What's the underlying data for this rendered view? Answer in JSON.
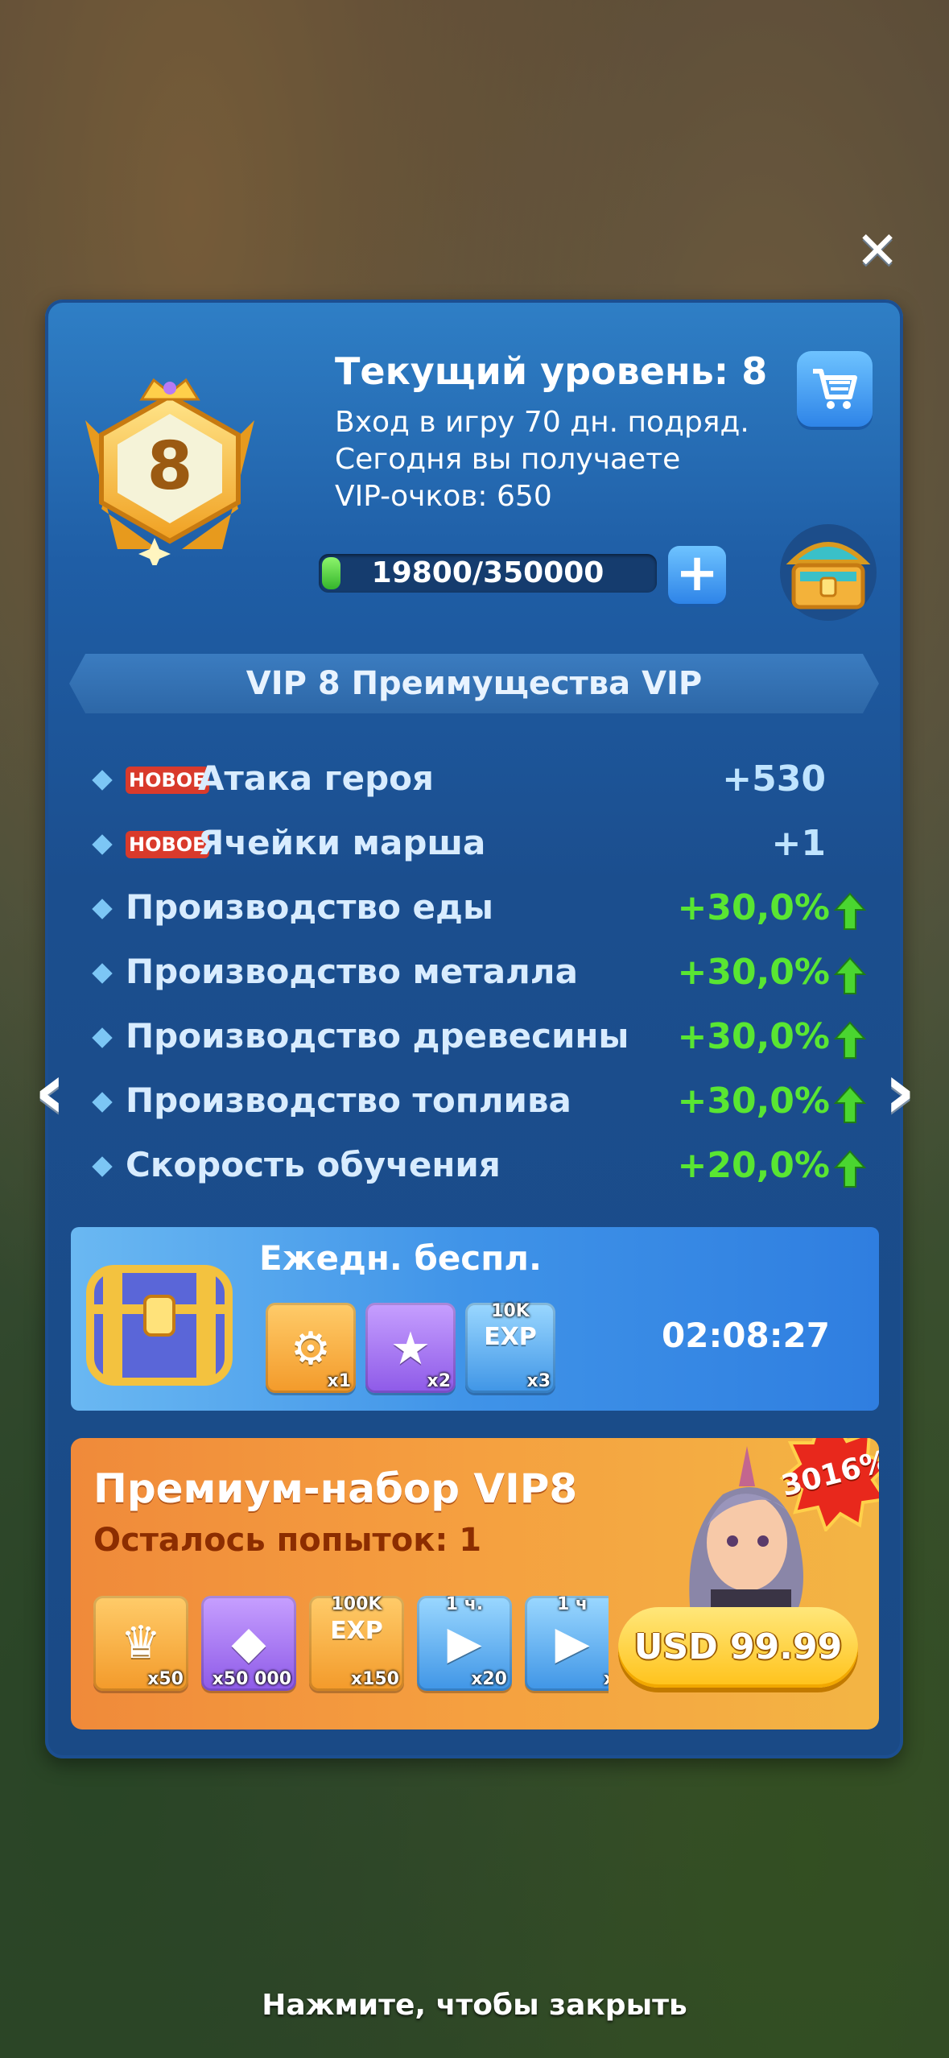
{
  "header": {
    "title": "Текущий уровень: 8",
    "lines": [
      "Вход в игру 70 дн. подряд.",
      "Сегодня вы получаете",
      "VIP-очков: 650"
    ],
    "badge_level": "8",
    "progress_text": "19800/350000",
    "progress_fraction": 0.0566
  },
  "benefits_title": "VIP 8 Преимущества VIP",
  "benefits": [
    {
      "new": "НОВОЕ",
      "label": "Атака героя",
      "value": "+530",
      "color": "blue",
      "arrow": false
    },
    {
      "new": "НОВОЕ",
      "label": "Ячейки марша",
      "value": "+1",
      "color": "blue",
      "arrow": false
    },
    {
      "new": "",
      "label": "Производство еды",
      "value": "+30,0%",
      "color": "green",
      "arrow": true
    },
    {
      "new": "",
      "label": "Производство металла",
      "value": "+30,0%",
      "color": "green",
      "arrow": true
    },
    {
      "new": "",
      "label": "Производство древесины",
      "value": "+30,0%",
      "color": "green",
      "arrow": true
    },
    {
      "new": "",
      "label": "Производство топлива",
      "value": "+30,0%",
      "color": "green",
      "arrow": true
    },
    {
      "new": "",
      "label": "Скорость обучения",
      "value": "+20,0%",
      "color": "green",
      "arrow": true
    }
  ],
  "daily": {
    "title": "Ежедн. беспл.",
    "timer": "02:08:27",
    "items": [
      {
        "icon": "speedup-badge-icon",
        "count": "x1",
        "top": "",
        "tile": "orange"
      },
      {
        "icon": "star-card-icon",
        "count": "x2",
        "top": "",
        "tile": "purple"
      },
      {
        "icon": "exp-badge-icon",
        "count": "x3",
        "top": "10K",
        "tile": "blue"
      }
    ]
  },
  "premium": {
    "title": "Премиум-набор VIP8",
    "subtitle": "Осталось попыток: 1",
    "percent": "3016%",
    "price": "USD 99.99",
    "items": [
      {
        "icon": "crown-coin-icon",
        "count": "x50",
        "top": "",
        "tile": "orange"
      },
      {
        "icon": "gem-icon",
        "count": "x50 000",
        "top": "",
        "tile": "purple"
      },
      {
        "icon": "exp-badge-icon",
        "count": "x150",
        "top": "100K",
        "tile": "orange"
      },
      {
        "icon": "hammer-speedup-icon",
        "count": "x20",
        "top": "1 ч.",
        "tile": "blue"
      },
      {
        "icon": "train-speedup-icon",
        "count": "x",
        "top": "1 ч",
        "tile": "blue"
      }
    ]
  },
  "close_hint": "Нажмите, чтобы закрыть",
  "colors": {
    "accent_blue": "#2e84e8",
    "value_green": "#59e632",
    "new_red": "#d93a2b",
    "premium_orange": "#f5a040"
  }
}
